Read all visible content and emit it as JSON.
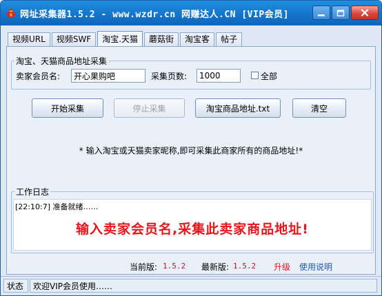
{
  "window": {
    "title": "网址采集器1.5.2 - www.wzdr.cn 网赚达人.CN [VIP会员]",
    "icon": "money-bag-icon"
  },
  "tabs": [
    {
      "label": "视频URL",
      "active": false
    },
    {
      "label": "视频SWF",
      "active": false
    },
    {
      "label": "淘宝.天猫",
      "active": true
    },
    {
      "label": "蘑菇街",
      "active": false
    },
    {
      "label": "淘宝客",
      "active": false
    },
    {
      "label": "帖子",
      "active": false
    }
  ],
  "collect_group": {
    "title": "淘宝、天猫商品地址采集",
    "seller_label": "卖家会员名:",
    "seller_value": "开心果购吧",
    "pages_label": "采集页数:",
    "pages_value": "1000",
    "all_label": "全部",
    "all_checked": false
  },
  "buttons": {
    "start": "开始采集",
    "stop": "停止采集",
    "export": "淘宝商品地址.txt",
    "clear": "清空"
  },
  "hint": "* 输入淘宝或天猫卖家昵称,即可采集此商家所有的商品地址!*",
  "log_group": {
    "title": "工作日志",
    "line": "[22:10:7] 准备就绪……",
    "banner": "输入卖家会员名,采集此卖家商品地址!"
  },
  "version": {
    "current_label": "当前版:",
    "current_value": "1.5.2",
    "latest_label": "最新版:",
    "latest_value": "1.5.2",
    "upgrade": "升级",
    "help": "使用说明"
  },
  "statusbar": {
    "label": "状态",
    "message": "欢迎VIP会员使用……"
  },
  "colors": {
    "title_bg": "#1473c9",
    "banner_red": "#e8141b",
    "link_blue": "#1f55c0"
  }
}
